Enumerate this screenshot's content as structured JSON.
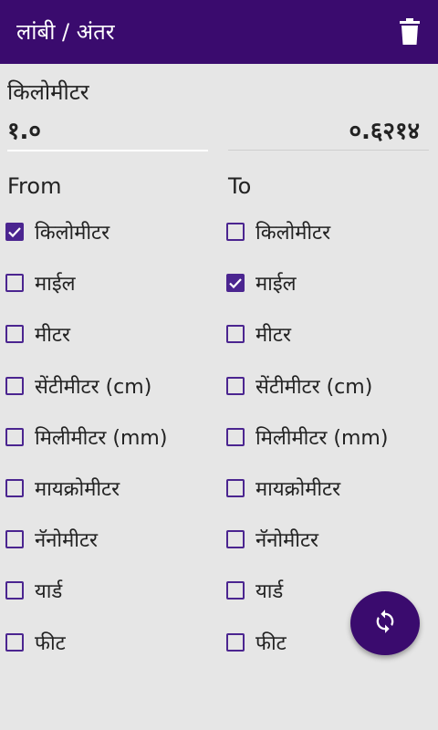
{
  "app": {
    "title": "लांबी / अंतर"
  },
  "converter": {
    "unit_label": "किलोमीटर",
    "input_value": "१.०",
    "output_value": "०.६२१४",
    "from_header": "From",
    "to_header": "To"
  },
  "from_options": [
    {
      "label": "किलोमीटर",
      "checked": true
    },
    {
      "label": "माईल",
      "checked": false
    },
    {
      "label": "मीटर",
      "checked": false
    },
    {
      "label": "सेंटीमीटर (cm)",
      "checked": false
    },
    {
      "label": "मिलीमीटर (mm)",
      "checked": false
    },
    {
      "label": "मायक्रोमीटर",
      "checked": false
    },
    {
      "label": "नॅनोमीटर",
      "checked": false
    },
    {
      "label": "यार्ड",
      "checked": false
    },
    {
      "label": "फीट",
      "checked": false
    }
  ],
  "to_options": [
    {
      "label": "किलोमीटर",
      "checked": false
    },
    {
      "label": "माईल",
      "checked": true
    },
    {
      "label": "मीटर",
      "checked": false
    },
    {
      "label": "सेंटीमीटर (cm)",
      "checked": false
    },
    {
      "label": "मिलीमीटर (mm)",
      "checked": false
    },
    {
      "label": "मायक्रोमीटर",
      "checked": false
    },
    {
      "label": "नॅनोमीटर",
      "checked": false
    },
    {
      "label": "यार्ड",
      "checked": false
    },
    {
      "label": "फीट",
      "checked": false
    }
  ],
  "colors": {
    "primary": "#3a0b6e",
    "accent": "#4b2590",
    "background": "#e6e6e6"
  },
  "icons": {
    "delete": "trash-icon",
    "swap": "refresh-icon"
  }
}
